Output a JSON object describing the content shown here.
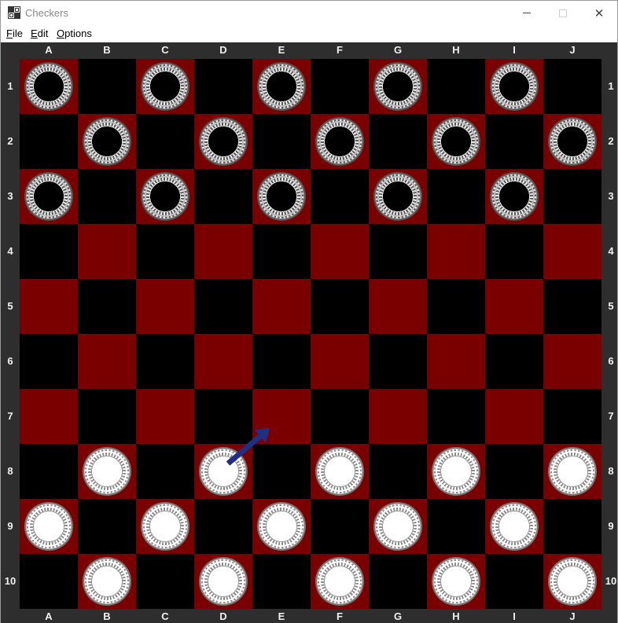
{
  "window": {
    "title": "Checkers",
    "min_icon": "minimize-icon",
    "max_icon": "maximize-icon",
    "close_glyph": "✕"
  },
  "menu": {
    "file": "F",
    "file_rest": "ile",
    "edit": "E",
    "edit_rest": "dit",
    "options": "O",
    "options_rest": "ptions"
  },
  "board": {
    "columns": [
      "A",
      "B",
      "C",
      "D",
      "E",
      "F",
      "G",
      "H",
      "I",
      "J"
    ],
    "rows": [
      "1",
      "2",
      "3",
      "4",
      "5",
      "6",
      "7",
      "8",
      "9",
      "10"
    ],
    "colors": {
      "light": "#7a0000",
      "dark": "#000000",
      "frame": "#2e2e2e",
      "arrow": "#1f2f86"
    },
    "black_pieces": [
      "A1",
      "C1",
      "E1",
      "G1",
      "I1",
      "B2",
      "D2",
      "F2",
      "H2",
      "J2",
      "A3",
      "C3",
      "E3",
      "G3",
      "I3"
    ],
    "white_pieces": [
      "B8",
      "D8",
      "F8",
      "H8",
      "J8",
      "A9",
      "C9",
      "E9",
      "G9",
      "I9",
      "B10",
      "D10",
      "F10",
      "H10",
      "J10"
    ],
    "move_hint": {
      "from": "D8",
      "to": "E7"
    }
  }
}
